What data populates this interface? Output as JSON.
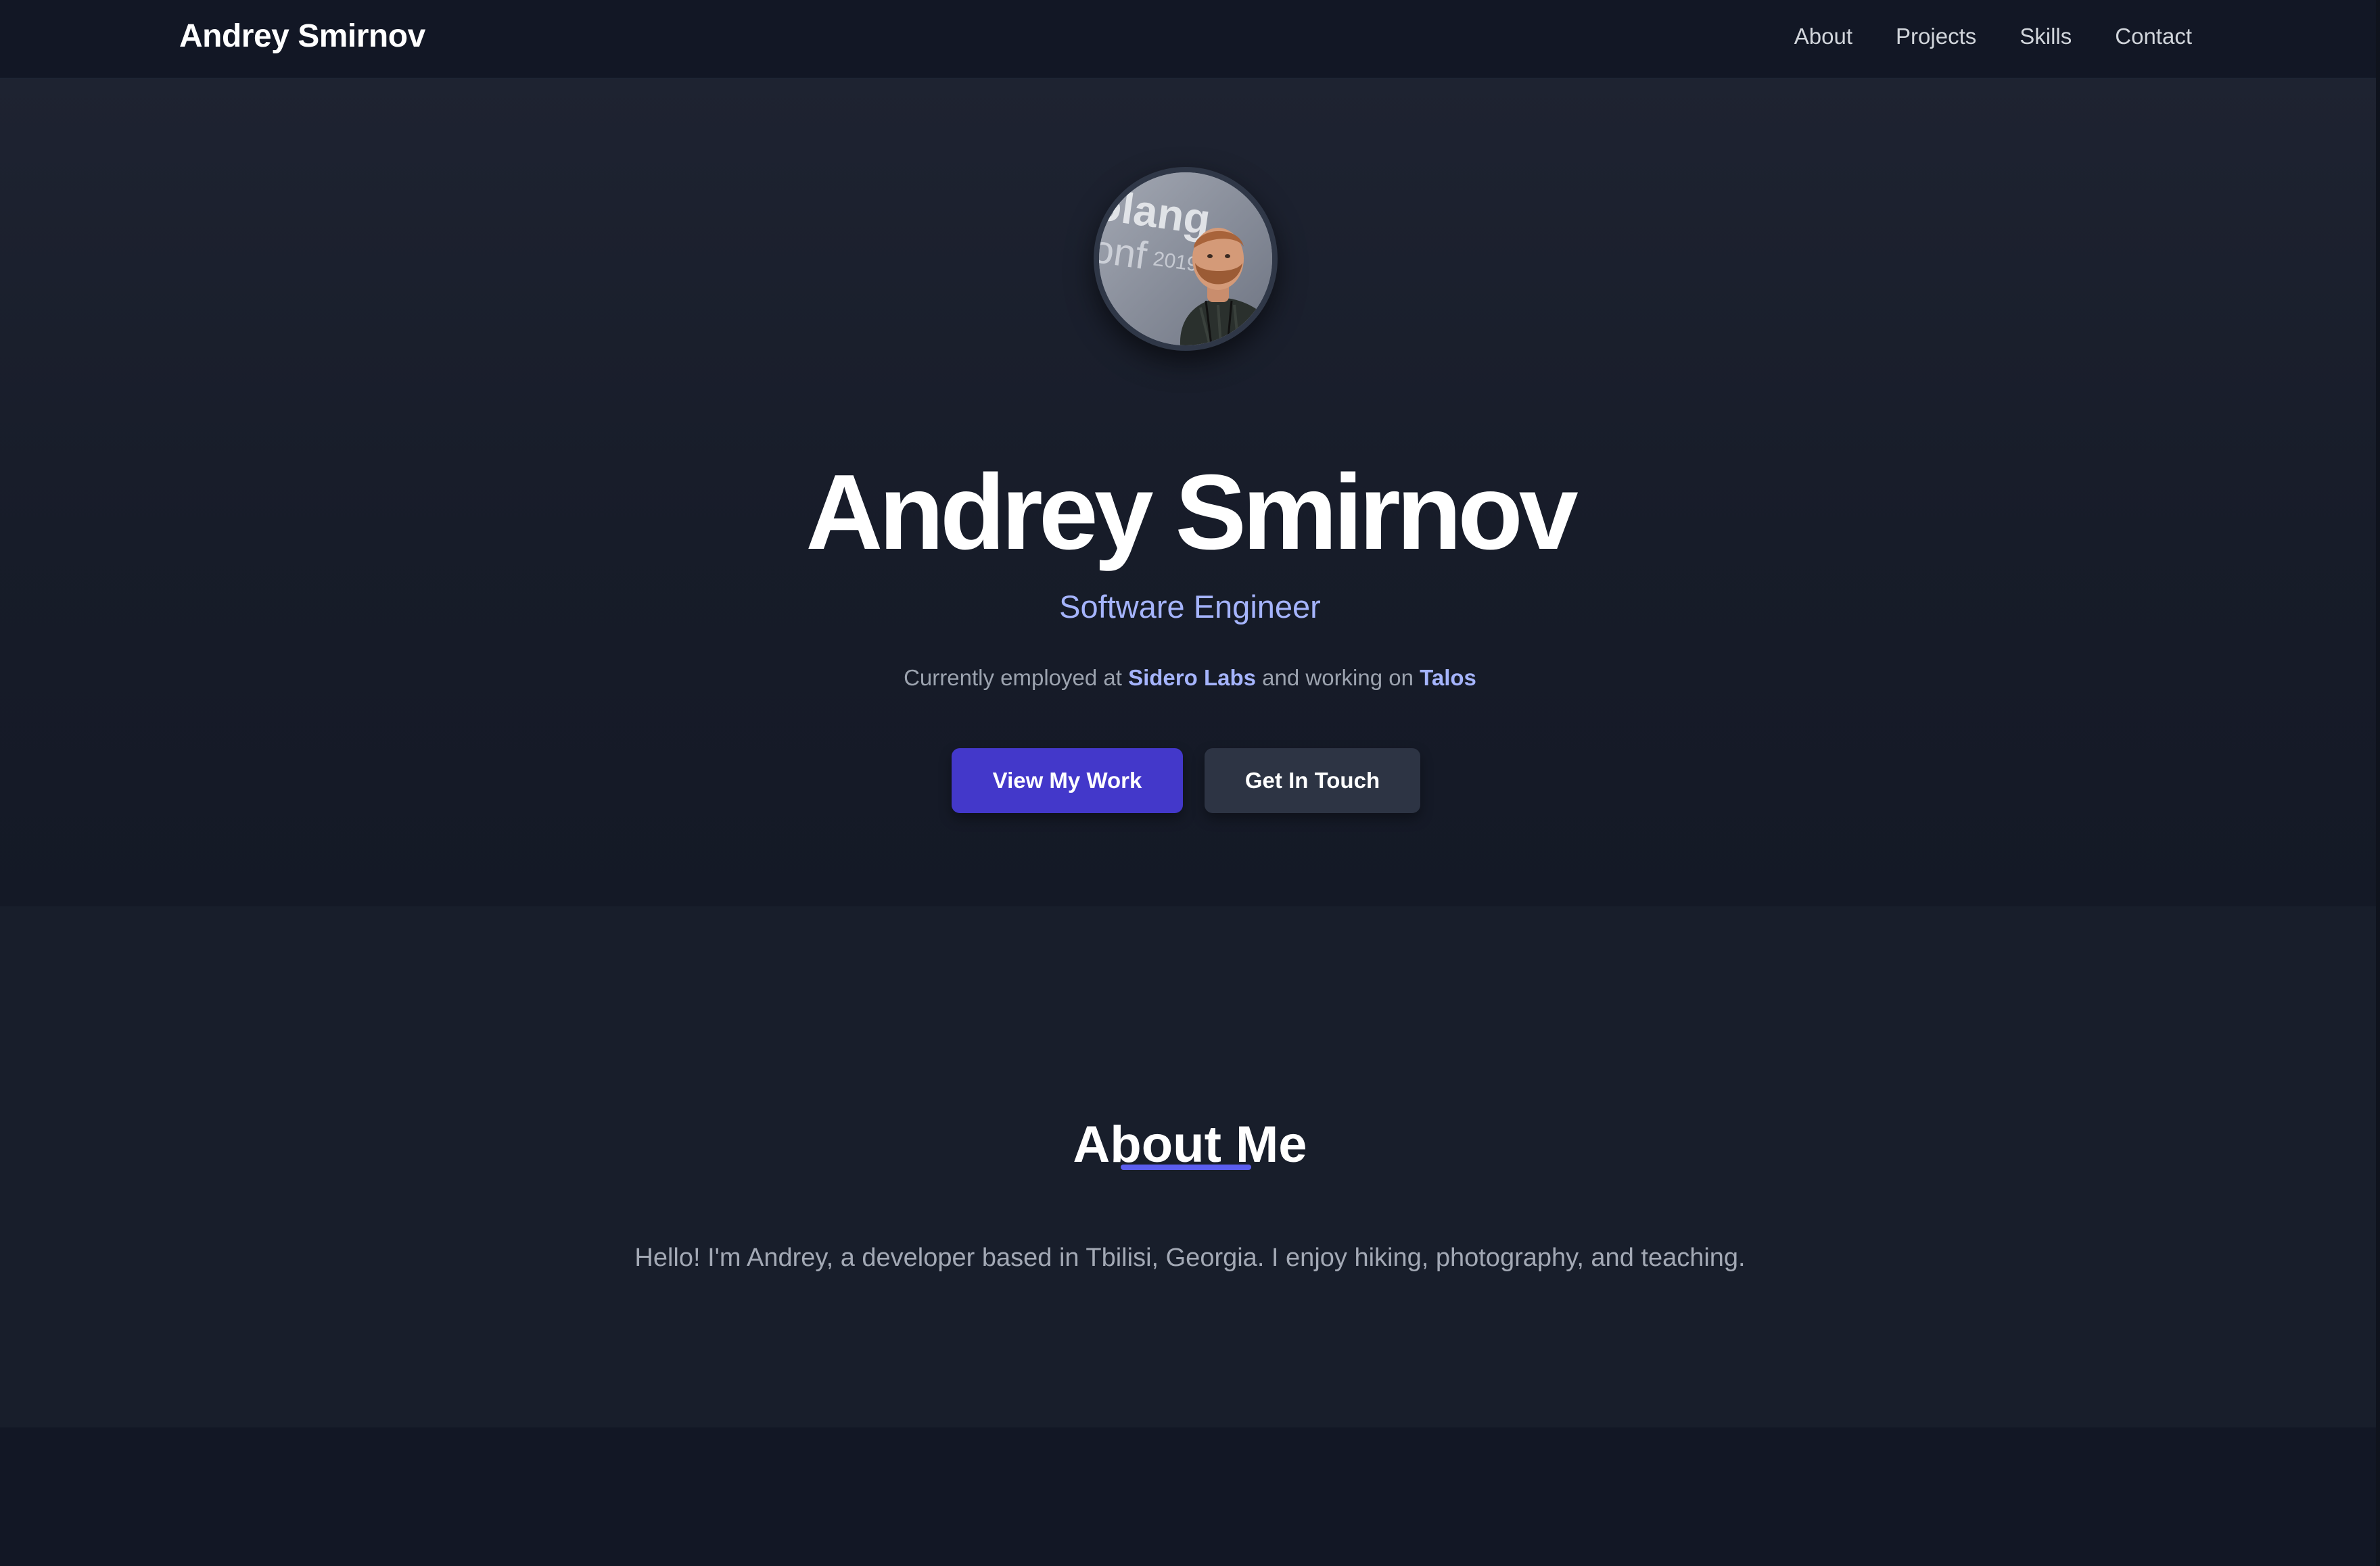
{
  "navbar": {
    "brand": "Andrey Smirnov",
    "links": [
      "About",
      "Projects",
      "Skills",
      "Contact"
    ]
  },
  "hero": {
    "avatar_alt": "avatar",
    "avatar_backdrop_text": "olang onf 2019",
    "name": "Andrey Smirnov",
    "role": "Software Engineer",
    "employment_prefix": "Currently employed at",
    "employer": "Sidero Labs",
    "employment_middle": "and working on",
    "project": "Talos",
    "primary_button": "View My Work",
    "secondary_button": "Get In Touch"
  },
  "about": {
    "title": "About Me",
    "body": "Hello! I'm Andrey, a developer based in Tbilisi, Georgia. I enjoy hiking, photography, and teaching."
  },
  "colors": {
    "background": "#121725",
    "accent": "#4338ca",
    "link": "#a5b4fc",
    "underline": "#5b5ef0"
  }
}
